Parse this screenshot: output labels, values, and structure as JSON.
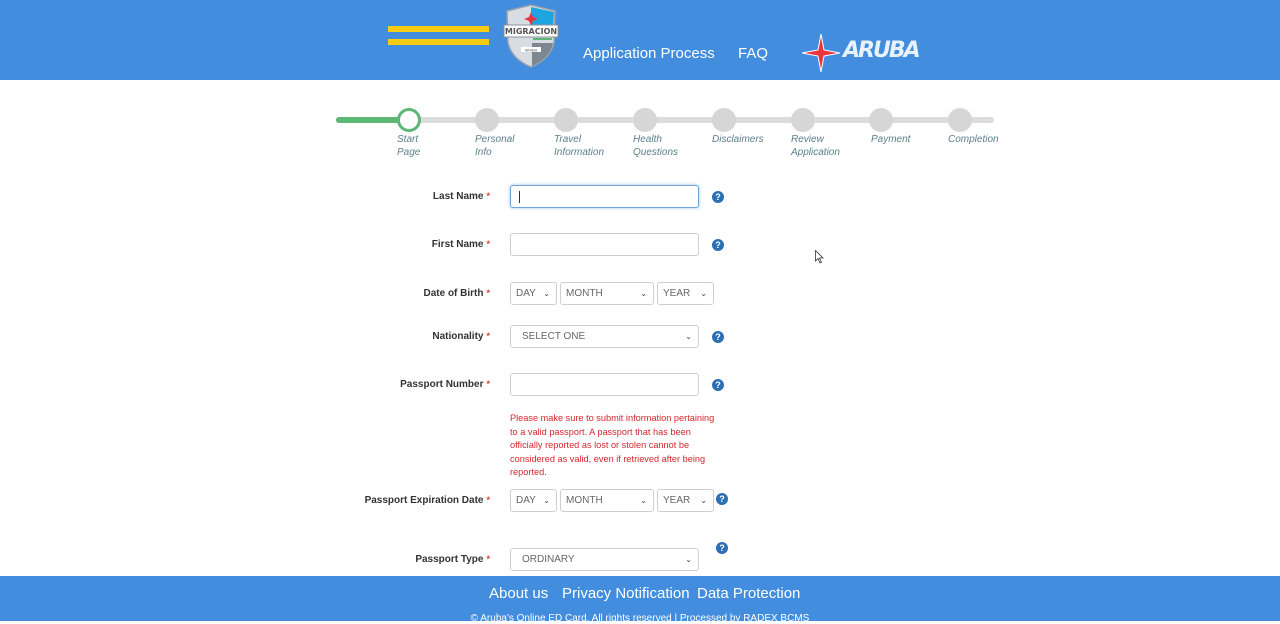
{
  "header": {
    "logo_text": "MIGRACION",
    "logo_subtext": "ARUBA",
    "nav": [
      {
        "label": "Application Process"
      },
      {
        "label": "FAQ"
      }
    ],
    "brand_word": "ARUBA",
    "colors": {
      "header_bg": "#428ddd",
      "flag_yellow": "#f6cd14",
      "star_red": "#e8353e"
    }
  },
  "stepper": {
    "current_step": 1,
    "steps": [
      {
        "label_line1": "Start",
        "label_line2": "Page"
      },
      {
        "label_line1": "Personal",
        "label_line2": "Info"
      },
      {
        "label_line1": "Travel",
        "label_line2": "Information"
      },
      {
        "label_line1": "Health",
        "label_line2": "Questions"
      },
      {
        "label_line1": "Disclaimers",
        "label_line2": ""
      },
      {
        "label_line1": "Review",
        "label_line2": "Application"
      },
      {
        "label_line1": "Payment",
        "label_line2": ""
      },
      {
        "label_line1": "Completion",
        "label_line2": ""
      }
    ],
    "colors": {
      "complete": "#5cb874",
      "pending": "#d6d6d6"
    }
  },
  "form": {
    "required_marker": "*",
    "last_name": {
      "label": "Last Name",
      "value": ""
    },
    "first_name": {
      "label": "First Name",
      "value": ""
    },
    "date_of_birth": {
      "label": "Date of Birth",
      "day": "DAY",
      "month": "MONTH",
      "year": "YEAR"
    },
    "nationality": {
      "label": "Nationality",
      "value": "SELECT ONE"
    },
    "passport_number": {
      "label": "Passport Number",
      "value": ""
    },
    "passport_warning": "Please make sure to submit information pertaining to a valid passport. A passport that has been officially reported as lost or stolen cannot be considered as valid, even if retrieved after being reported.",
    "passport_expiration": {
      "label": "Passport Expiration Date",
      "day": "DAY",
      "month": "MONTH",
      "year": "YEAR"
    },
    "passport_type": {
      "label": "Passport Type",
      "value": "ORDINARY"
    },
    "help_glyph": "?",
    "chevron_glyph": "⌄"
  },
  "footer": {
    "links": [
      {
        "label": "About us"
      },
      {
        "label": "Privacy Notification"
      },
      {
        "label": "Data Protection"
      }
    ],
    "copyright": "©  Aruba's Online ED Card. All rights reserved | Processed by RADEX BCMS"
  }
}
